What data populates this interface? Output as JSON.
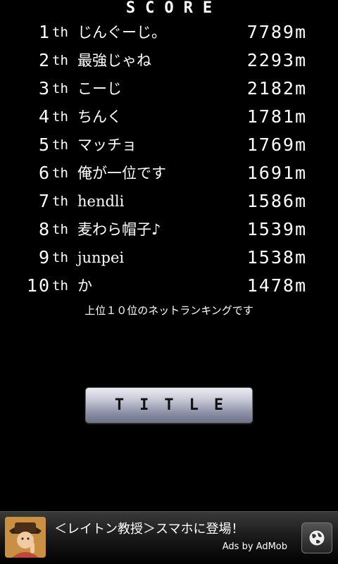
{
  "header": {
    "title": "SCORE"
  },
  "rankings": [
    {
      "rank": "1",
      "suffix": "th",
      "name": "じんぐーじ。",
      "distance": "7789m"
    },
    {
      "rank": "2",
      "suffix": "th",
      "name": "最強じゃね",
      "distance": "2293m"
    },
    {
      "rank": "3",
      "suffix": "th",
      "name": "こーじ",
      "distance": "2182m"
    },
    {
      "rank": "4",
      "suffix": "th",
      "name": "ちんく",
      "distance": "1781m"
    },
    {
      "rank": "5",
      "suffix": "th",
      "name": "マッチョ",
      "distance": "1769m"
    },
    {
      "rank": "6",
      "suffix": "th",
      "name": "俺が一位です",
      "distance": "1691m"
    },
    {
      "rank": "7",
      "suffix": "th",
      "name": "hendli",
      "distance": "1586m"
    },
    {
      "rank": "8",
      "suffix": "th",
      "name": "麦わら帽子♪",
      "distance": "1539m"
    },
    {
      "rank": "9",
      "suffix": "th",
      "name": "junpei",
      "distance": "1538m"
    },
    {
      "rank": "10",
      "suffix": "th",
      "name": "か",
      "distance": "1478m"
    }
  ],
  "note": "上位１０位のネットランキングです",
  "buttons": {
    "title_label": "TITLE"
  },
  "ad": {
    "text": "＜レイトン教授＞スマホに登場！",
    "by": "Ads by AdMob",
    "thumb_icon": "professor-avatar-icon",
    "globe_icon": "globe-icon"
  }
}
